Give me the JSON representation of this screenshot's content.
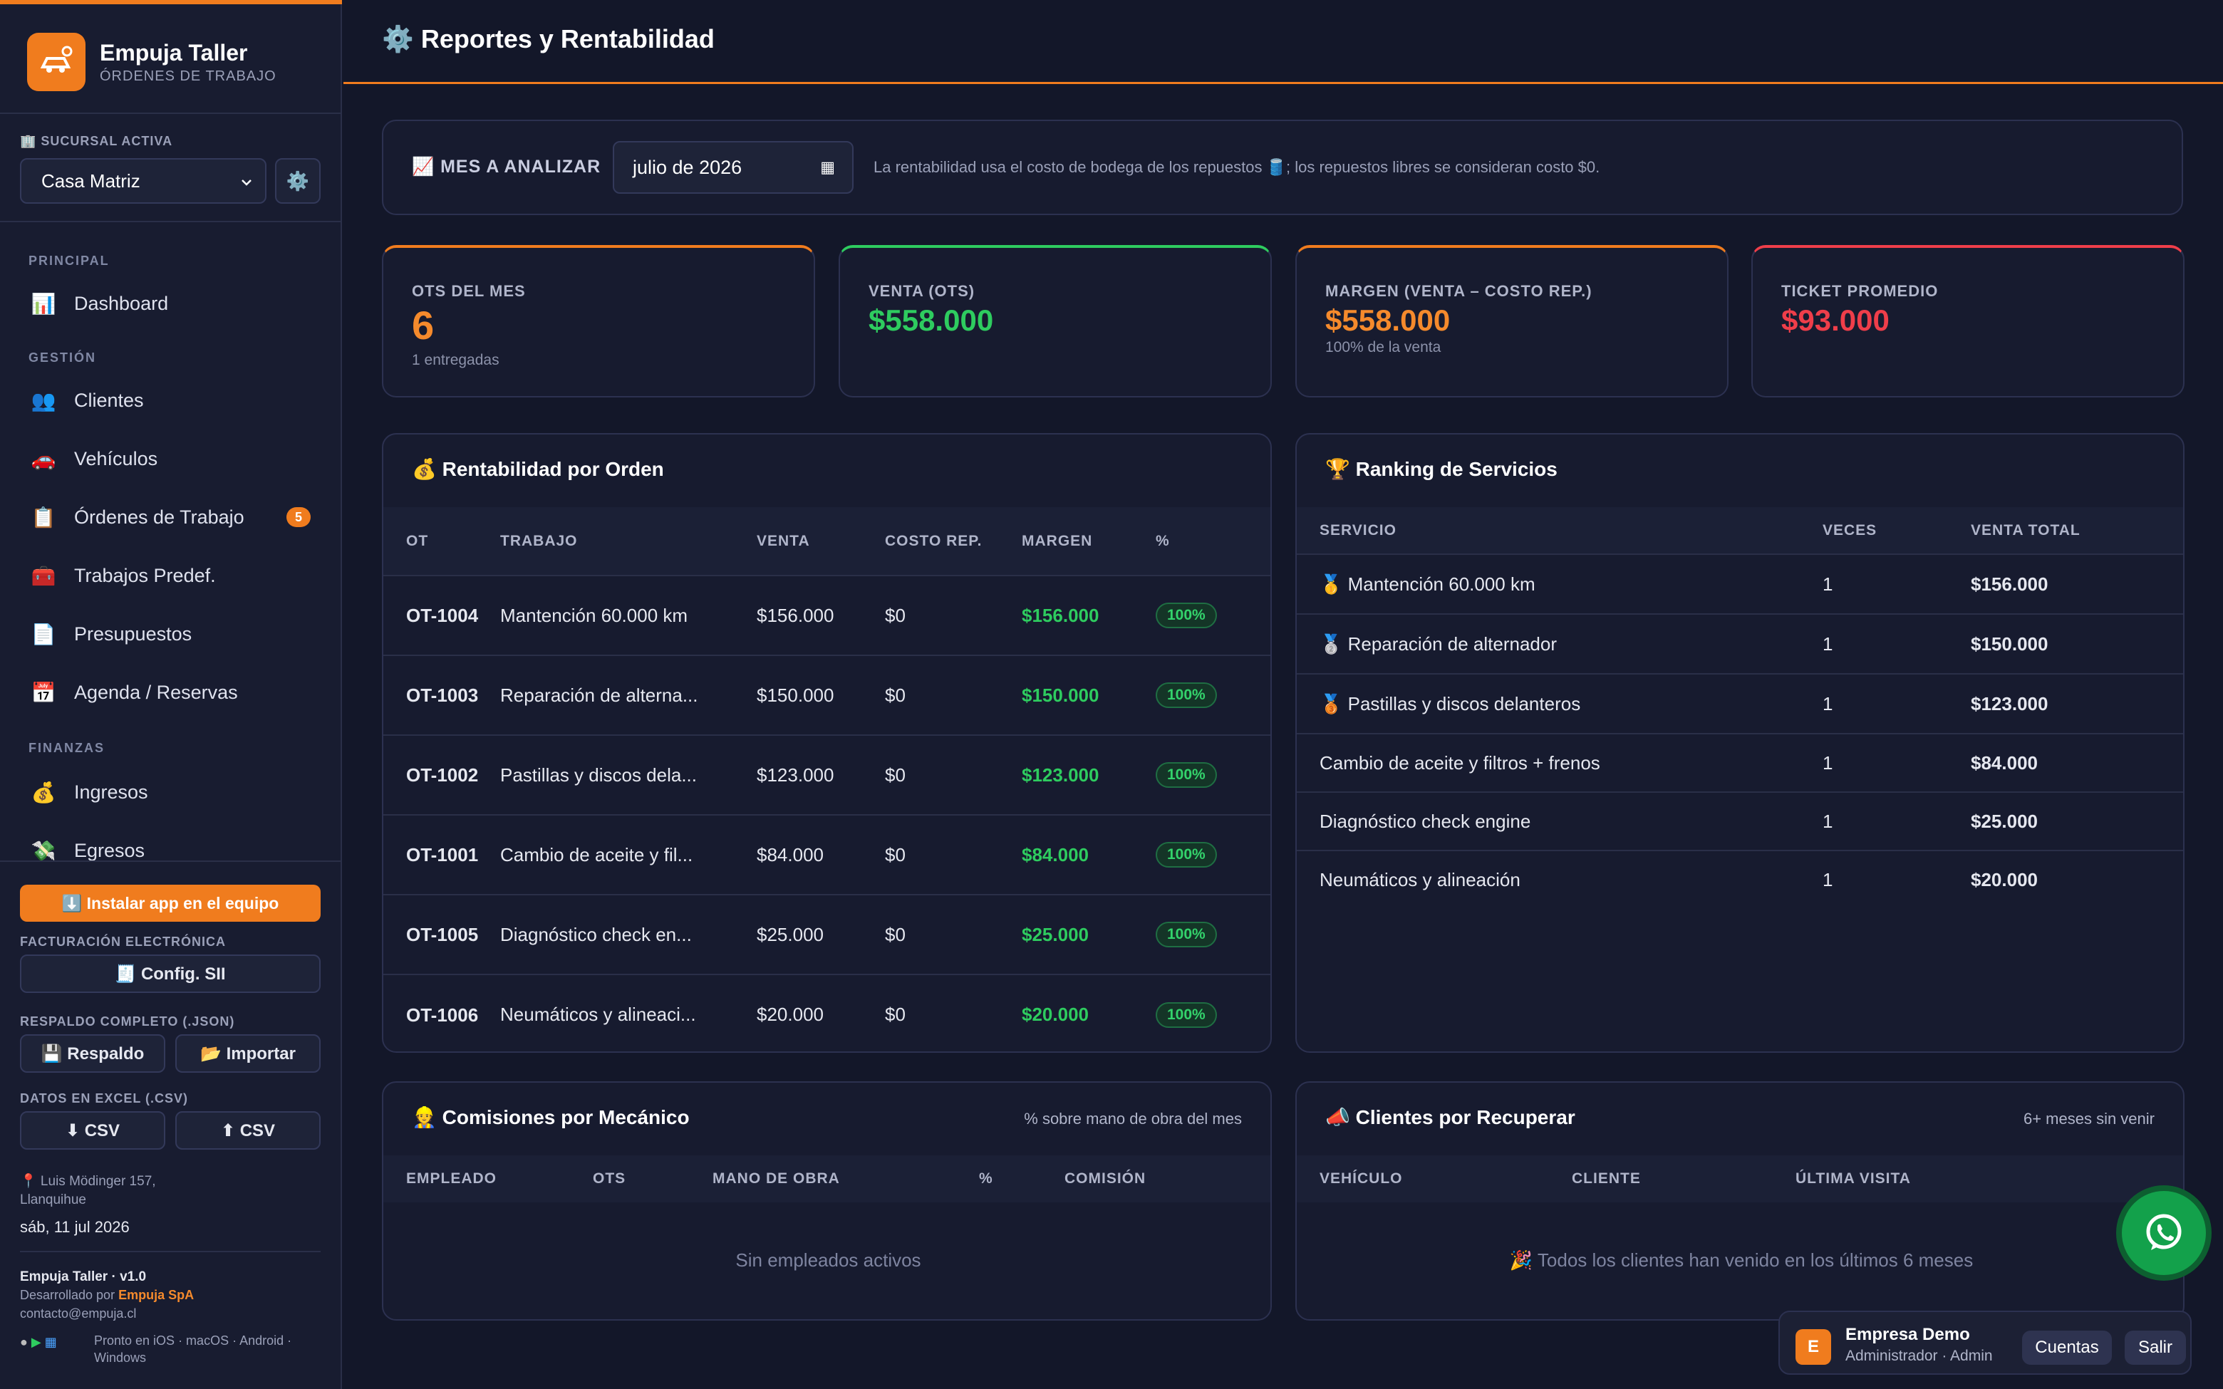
{
  "brand": {
    "name": "Empuja Taller",
    "subtitle": "ÓRDENES DE TRABAJO"
  },
  "branch": {
    "label": "🏢 SUCURSAL ACTIVA",
    "value": "Casa Matriz"
  },
  "nav": {
    "principal": "PRINCIPAL",
    "gestion": "GESTIÓN",
    "finanzas": "FINANZAS",
    "items": [
      {
        "icon": "📊",
        "label": "Dashboard"
      },
      {
        "icon": "👥",
        "label": "Clientes"
      },
      {
        "icon": "🚗",
        "label": "Vehículos"
      },
      {
        "icon": "📋",
        "label": "Órdenes de Trabajo",
        "badge": "5"
      },
      {
        "icon": "🧰",
        "label": "Trabajos Predef."
      },
      {
        "icon": "📄",
        "label": "Presupuestos"
      },
      {
        "icon": "📅",
        "label": "Agenda / Reservas"
      },
      {
        "icon": "💰",
        "label": "Ingresos"
      },
      {
        "icon": "💸",
        "label": "Egresos"
      }
    ]
  },
  "side_footer": {
    "install": "⬇️ Instalar app en el equipo",
    "facturacion_label": "FACTURACIÓN ELECTRÓNICA",
    "config_sii": "🧾 Config. SII",
    "respaldo_label": "RESPALDO COMPLETO (.JSON)",
    "respaldo": "💾 Respaldo",
    "importar": "📂 Importar",
    "excel_label": "DATOS EN EXCEL (.CSV)",
    "csv_down": "⬇ CSV",
    "csv_up": "⬆ CSV",
    "address1": "📍 Luis Mödinger 157,",
    "address2": "Llanquihue",
    "date": "sáb, 11 jul 2026",
    "version": "Empuja Taller · v1.0",
    "dev_prefix": "Desarrollado por",
    "dev_name": "Empuja SpA",
    "email": "contacto@empuja.cl",
    "platforms1": "Pronto en iOS · macOS · Android ·",
    "platforms2": "Windows"
  },
  "header": {
    "title": "⚙️ Reportes y Rentabilidad"
  },
  "filter": {
    "label": "📈 MES A ANALIZAR",
    "month": "julio de 2026",
    "note": "La rentabilidad usa el costo de bodega de los repuestos 🛢️; los repuestos libres se consideran costo $0."
  },
  "kpis": [
    {
      "label": "OTS DEL MES",
      "value": "6",
      "sub": "1 entregadas",
      "color": "#f58a2c",
      "bar": "#f07c1e"
    },
    {
      "label": "VENTA (OTS)",
      "value": "$558.000",
      "sub": "",
      "color": "#2ecc5f",
      "bar": "#2ecc5f"
    },
    {
      "label": "MARGEN (VENTA – COSTO REP.)",
      "value": "$558.000",
      "sub": "100% de la venta",
      "color": "#f58a2c",
      "bar": "#f07c1e"
    },
    {
      "label": "TICKET PROMEDIO",
      "value": "$93.000",
      "sub": "",
      "color": "#ef3e4a",
      "bar": "#ef3e4a"
    }
  ],
  "rent": {
    "title": "💰 Rentabilidad por Orden",
    "headers": [
      "OT",
      "TRABAJO",
      "VENTA",
      "COSTO REP.",
      "MARGEN",
      "%"
    ],
    "rows": [
      {
        "ot": "OT-1004",
        "trabajo": "Mantención 60.000 km",
        "venta": "$156.000",
        "costo": "$0",
        "margen": "$156.000",
        "pct": "100%"
      },
      {
        "ot": "OT-1003",
        "trabajo": "Reparación de alterna...",
        "venta": "$150.000",
        "costo": "$0",
        "margen": "$150.000",
        "pct": "100%"
      },
      {
        "ot": "OT-1002",
        "trabajo": "Pastillas y discos dela...",
        "venta": "$123.000",
        "costo": "$0",
        "margen": "$123.000",
        "pct": "100%"
      },
      {
        "ot": "OT-1001",
        "trabajo": "Cambio de aceite y fil...",
        "venta": "$84.000",
        "costo": "$0",
        "margen": "$84.000",
        "pct": "100%"
      },
      {
        "ot": "OT-1005",
        "trabajo": "Diagnóstico check en...",
        "venta": "$25.000",
        "costo": "$0",
        "margen": "$25.000",
        "pct": "100%"
      },
      {
        "ot": "OT-1006",
        "trabajo": "Neumáticos y alineaci...",
        "venta": "$20.000",
        "costo": "$0",
        "margen": "$20.000",
        "pct": "100%"
      }
    ]
  },
  "ranking": {
    "title": "🏆 Ranking de Servicios",
    "headers": [
      "SERVICIO",
      "VECES",
      "VENTA TOTAL"
    ],
    "rows": [
      {
        "servicio": "🥇 Mantención 60.000 km",
        "veces": "1",
        "venta": "$156.000"
      },
      {
        "servicio": "🥈 Reparación de alternador",
        "veces": "1",
        "venta": "$150.000"
      },
      {
        "servicio": "🥉 Pastillas y discos delanteros",
        "veces": "1",
        "venta": "$123.000"
      },
      {
        "servicio": "Cambio de aceite y filtros + frenos",
        "veces": "1",
        "venta": "$84.000"
      },
      {
        "servicio": "Diagnóstico check engine",
        "veces": "1",
        "venta": "$25.000"
      },
      {
        "servicio": "Neumáticos y alineación",
        "veces": "1",
        "venta": "$20.000"
      }
    ]
  },
  "comisiones": {
    "title": "👷 Comisiones por Mecánico",
    "note": "% sobre mano de obra del mes",
    "headers": [
      "EMPLEADO",
      "OTS",
      "MANO DE OBRA",
      "%",
      "COMISIÓN"
    ],
    "empty": "Sin empleados activos"
  },
  "recuperar": {
    "title": "📣 Clientes por Recuperar",
    "note": "6+ meses sin venir",
    "headers": [
      "VEHÍCULO",
      "CLIENTE",
      "ÚLTIMA VISITA"
    ],
    "empty": "🎉 Todos los clientes han venido en los últimos 6 meses"
  },
  "user": {
    "initial": "E",
    "name": "Empresa Demo",
    "role": "Administrador · Admin",
    "cuentas": "Cuentas",
    "salir": "Salir"
  }
}
